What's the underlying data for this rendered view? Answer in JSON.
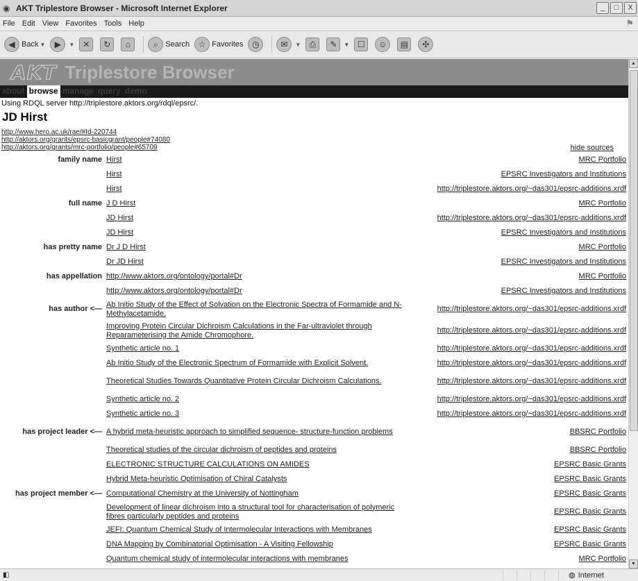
{
  "window": {
    "title": "AKT Triplestore Browser - Microsoft Internet Explorer",
    "minimize": "_",
    "maximize": "□",
    "close": "X"
  },
  "menu": [
    "File",
    "Edit",
    "View",
    "Favorites",
    "Tools",
    "Help"
  ],
  "toolbar": {
    "back_label": "Back",
    "search_label": "Search",
    "favorites_label": "Favorites"
  },
  "banner": {
    "logo": "AKT",
    "title": "Triplestore Browser"
  },
  "nav": {
    "items": [
      "about",
      "browse",
      "manage",
      "query",
      "demo"
    ],
    "active": "browse"
  },
  "server_text": "Using RDQL server http://triplestore.aktors.org/rdql/epsrc/.",
  "entity_title": "JD Hirst",
  "sources": [
    "http://www.hero.ac.uk/rae/#Id-220744",
    "http://aktors.org/grants/epsrc-basicgrant/people#74080",
    "http://aktors.org/grants/mrc-portfolio/people#65709"
  ],
  "hide_sources": "hide sources",
  "properties": [
    {
      "name": "family name",
      "value": "Hirst",
      "source": "MRC Portfolio"
    },
    {
      "name": "",
      "value": "Hirst",
      "source": "EPSRC Investigators and Institutions"
    },
    {
      "name": "",
      "value": "Hirst",
      "source": "http://triplestore.aktors.org/~das301/epsrc-additions.xrdf"
    },
    {
      "name": "full name",
      "value": "J D Hirst",
      "source": "MRC Portfolio"
    },
    {
      "name": "",
      "value": "JD Hirst",
      "source": "http://triplestore.aktors.org/~das301/epsrc-additions.xrdf"
    },
    {
      "name": "",
      "value": "JD Hirst",
      "source": "EPSRC Investigators and Institutions"
    },
    {
      "name": "has pretty name",
      "value": "Dr J D Hirst",
      "source": "MRC Portfolio"
    },
    {
      "name": "",
      "value": "Dr JD Hirst",
      "source": "EPSRC Investigators and Institutions"
    },
    {
      "name": "has appellation",
      "value": "http://www.aktors.org/ontology/portal#Dr",
      "source": "MRC Portfolio"
    },
    {
      "name": "",
      "value": "http://www.aktors.org/ontology/portal#Dr",
      "source": "EPSRC Investigators and Institutions"
    },
    {
      "name": "has author <—",
      "value": "Ab Initio Study of the Effect of Solvation on the Electronic Spectra of Formamide and N-Methylacetamide.",
      "source": "http://triplestore.aktors.org/~das301/epsrc-additions.xrdf"
    },
    {
      "name": "",
      "value": "Improving Protein Circular Dichroism Calculations in the Far-ultraviolet through Reparameterising the Amide Chromophore.",
      "source": "http://triplestore.aktors.org/~das301/epsrc-additions.xrdf"
    },
    {
      "name": "",
      "value": "Synthetic article no. 1",
      "source": "http://triplestore.aktors.org/~das301/epsrc-additions.xrdf"
    },
    {
      "name": "",
      "value": "Ab Initio Study of the Electronic Spectrum of Formamide with Explicit Solvent.",
      "source": "http://triplestore.aktors.org/~das301/epsrc-additions.xrdf"
    },
    {
      "name": "",
      "value": "Theoretical Studies Towards Quantitative Protein Circular Dichroism Calculations.",
      "source": "http://triplestore.aktors.org/~das301/epsrc-additions.xrdf"
    },
    {
      "name": "",
      "value": "Synthetic article no. 2",
      "source": "http://triplestore.aktors.org/~das301/epsrc-additions.xrdf"
    },
    {
      "name": "",
      "value": "Synthetic article no. 3",
      "source": "http://triplestore.aktors.org/~das301/epsrc-additions.xrdf"
    },
    {
      "name": "has project leader <—",
      "value": "A hybrid meta-heuristic approach to simplified sequence- structure-function problems",
      "source": "BBSRC Portfolio"
    },
    {
      "name": "",
      "value": "Theoretical studies of the circular dichroism of peptides and proteins",
      "source": "BBSRC Portfolio"
    },
    {
      "name": "",
      "value": "ELECTRONIC STRUCTURE CALCULATIONS ON AMIDES",
      "source": "EPSRC Basic Grants"
    },
    {
      "name": "",
      "value": "Hybrid Meta-heuristic Optimisation of Chiral Catalysts",
      "source": "EPSRC Basic Grants"
    },
    {
      "name": "has project member <—",
      "value": "Computational Chemistry at the University of Nottingham",
      "source": "EPSRC Basic Grants"
    },
    {
      "name": "",
      "value": "Development of linear dichroism into a structural tool for characterisation of polymeric fibres particularly peptides and proteins",
      "source": "EPSRC Basic Grants"
    },
    {
      "name": "",
      "value": "JEFI: Quantum Chemical Study of Intermolecular Interactions with Membranes",
      "source": "EPSRC Basic Grants"
    },
    {
      "name": "",
      "value": "DNA Mapping by Combinatorial Optimisation - A Visiting Fellowship",
      "source": "EPSRC Basic Grants"
    },
    {
      "name": "",
      "value": "Quantum chemical study of intermolecular interactions with membranes",
      "source": "MRC Portfolio"
    }
  ],
  "status": {
    "zone": "Internet"
  }
}
